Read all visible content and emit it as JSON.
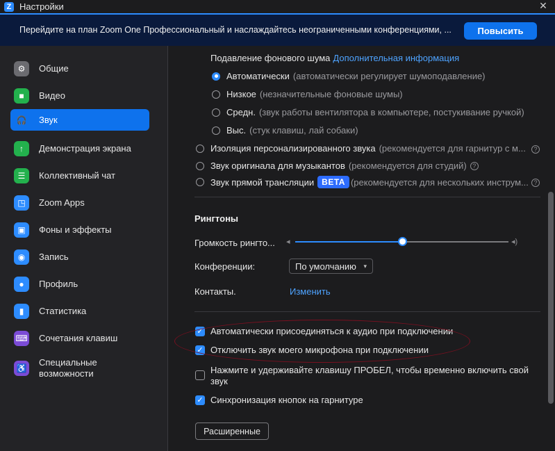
{
  "window": {
    "title": "Настройки",
    "close_glyph": "✕",
    "logo_letter": "Z"
  },
  "banner": {
    "text": "Перейдите на план Zoom One Профессиональный и наслаждайтесь неограниченными конференциями, ...",
    "button": "Повысить"
  },
  "sidebar": {
    "items": [
      {
        "label": "Общие",
        "icon": "gear-icon",
        "color": "#6b6b70",
        "glyph": "⚙"
      },
      {
        "label": "Видео",
        "icon": "video-camera-icon",
        "color": "#23b14d",
        "glyph": "■"
      },
      {
        "label": "Звук",
        "icon": "headphones-icon",
        "color": "#0e72ed",
        "glyph": "🎧"
      },
      {
        "label": "Демонстрация экрана",
        "icon": "share-screen-icon",
        "color": "#23b14d",
        "glyph": "↑"
      },
      {
        "label": "Коллективный чат",
        "icon": "chat-icon",
        "color": "#23b14d",
        "glyph": "☰"
      },
      {
        "label": "Zoom Apps",
        "icon": "apps-icon",
        "color": "#2d8cff",
        "glyph": "◳"
      },
      {
        "label": "Фоны и эффекты",
        "icon": "background-icon",
        "color": "#2d8cff",
        "glyph": "▣"
      },
      {
        "label": "Запись",
        "icon": "record-icon",
        "color": "#2d8cff",
        "glyph": "◉"
      },
      {
        "label": "Профиль",
        "icon": "profile-icon",
        "color": "#2d8cff",
        "glyph": "●"
      },
      {
        "label": "Статистика",
        "icon": "statistics-icon",
        "color": "#2d8cff",
        "glyph": "▮"
      },
      {
        "label": "Сочетания клавиш",
        "icon": "keyboard-icon",
        "color": "#7b4bd6",
        "glyph": "⌨"
      },
      {
        "label": "Специальные возможности",
        "icon": "accessibility-icon",
        "color": "#7b4bd6",
        "glyph": "♿"
      }
    ],
    "active_index": 2
  },
  "noise": {
    "title": "Подавление фонового шума",
    "link": "Дополнительная информация",
    "options": [
      {
        "label": "Автоматически",
        "desc": "(автоматически регулирует шумоподавление)",
        "checked": true
      },
      {
        "label": "Низкое",
        "desc": "(незначительные фоновые шумы)",
        "checked": false
      },
      {
        "label": "Средн.",
        "desc": "(звук работы вентилятора в компьютере, постукивание ручкой)",
        "checked": false
      },
      {
        "label": "Выс.",
        "desc": "(стук клавиш, лай собаки)",
        "checked": false
      }
    ]
  },
  "audio_modes": [
    {
      "label": "Изоляция персонализированного звука",
      "desc": "(рекомендуется для гарнитур с м...",
      "help": "?"
    },
    {
      "label": "Звук оригинала для музыкантов",
      "desc": "(рекомендуется для студий)",
      "help": "?"
    },
    {
      "label": "Звук прямой трансляции",
      "badge": "BETA",
      "desc": "(рекомендуется для нескольких инструм...",
      "help": "?"
    }
  ],
  "ringtones": {
    "title": "Рингтоны",
    "volume_label": "Громкость рингто...",
    "volume_level": 0.5,
    "meetings_label": "Конференции:",
    "meetings_value": "По умолчанию",
    "contacts_label": "Контакты.",
    "contacts_link": "Изменить"
  },
  "checkboxes": [
    {
      "label": "Автоматически присоединяться к аудио при подключении",
      "checked": true
    },
    {
      "label": "Отключить звук моего микрофона при подключении",
      "checked": true
    },
    {
      "label": "Нажмите и удерживайте клавишу ПРОБЕЛ, чтобы временно включить свой",
      "label2": "звук",
      "checked": false
    },
    {
      "label": "Синхронизация кнопок на гарнитуре",
      "checked": true
    }
  ],
  "advanced_button": "Расширенные",
  "colors": {
    "accent": "#0e72ed",
    "annotation": "#7a1020",
    "link": "#4ea3ff"
  }
}
